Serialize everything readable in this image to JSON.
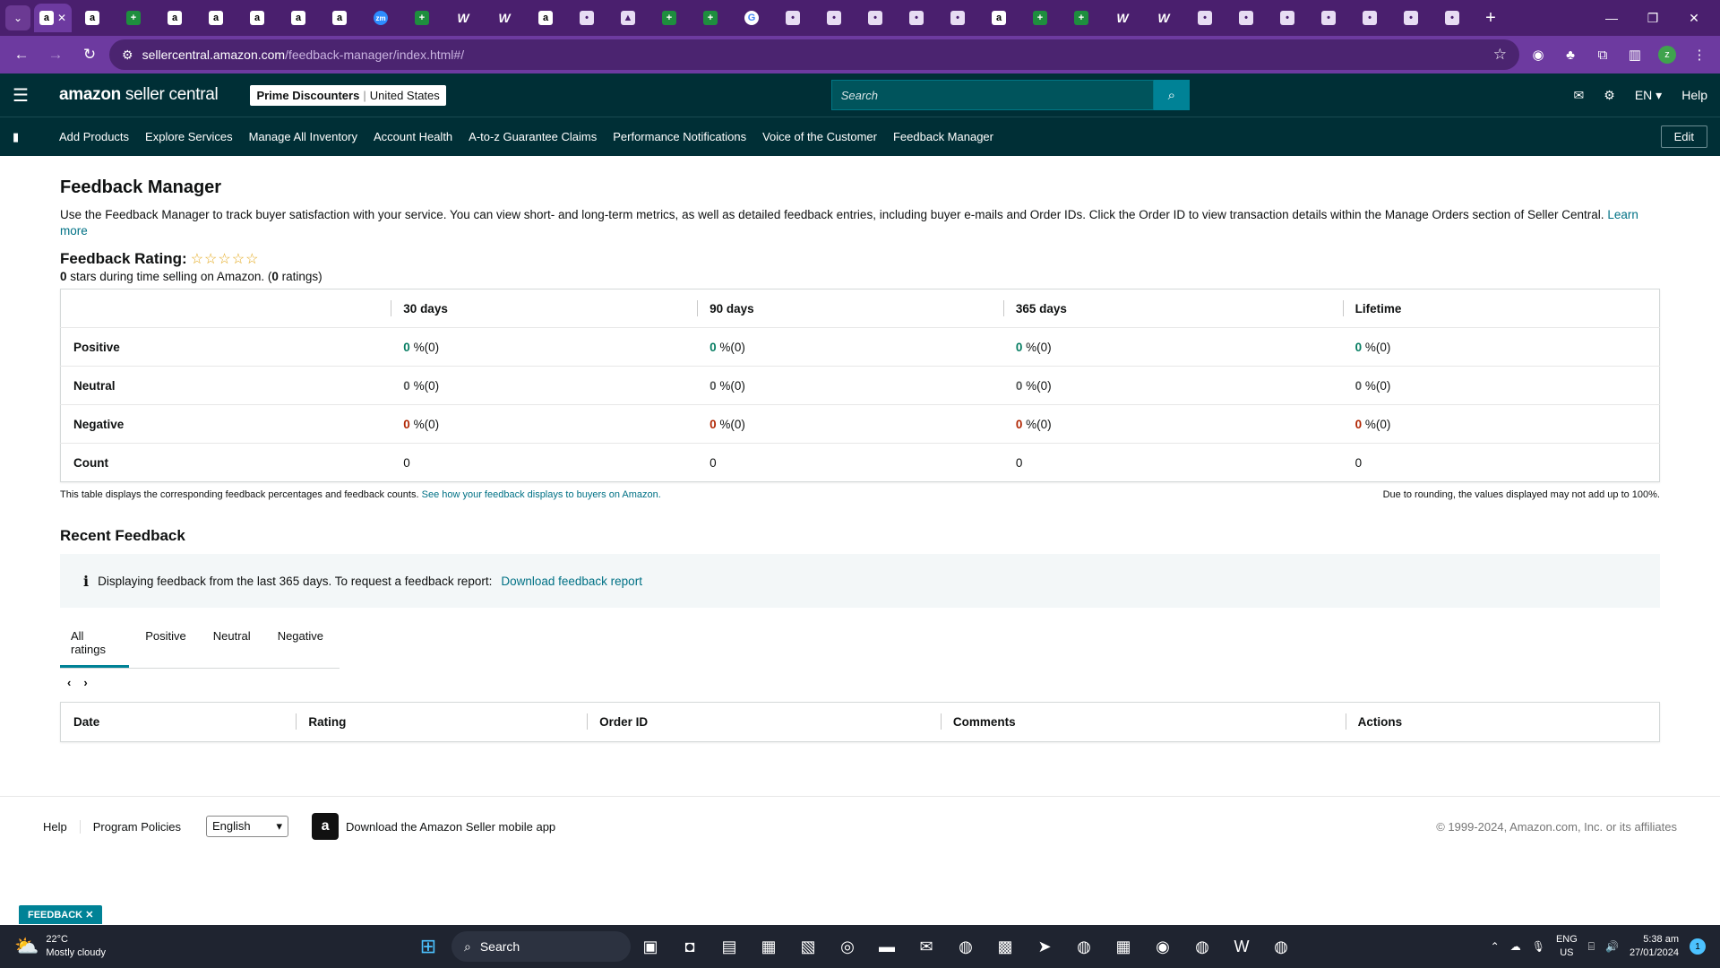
{
  "browser": {
    "tabs": [
      {
        "icon": "amazon",
        "active": true
      },
      {
        "icon": "amazon"
      },
      {
        "icon": "sheets"
      },
      {
        "icon": "amazon"
      },
      {
        "icon": "amazon"
      },
      {
        "icon": "amazon"
      },
      {
        "icon": "amazon"
      },
      {
        "icon": "amazon"
      },
      {
        "icon": "zoom"
      },
      {
        "icon": "sheets"
      },
      {
        "icon": "w"
      },
      {
        "icon": "w"
      },
      {
        "icon": "amazon"
      },
      {
        "icon": "other"
      },
      {
        "icon": "drive"
      },
      {
        "icon": "sheets"
      },
      {
        "icon": "sheets"
      },
      {
        "icon": "google"
      },
      {
        "icon": "other"
      },
      {
        "icon": "other"
      },
      {
        "icon": "other"
      },
      {
        "icon": "other"
      },
      {
        "icon": "other"
      },
      {
        "icon": "amazon"
      },
      {
        "icon": "sheets"
      },
      {
        "icon": "sheets"
      },
      {
        "icon": "w"
      },
      {
        "icon": "w"
      },
      {
        "icon": "other"
      },
      {
        "icon": "other"
      },
      {
        "icon": "other"
      },
      {
        "icon": "other"
      },
      {
        "icon": "other"
      },
      {
        "icon": "other"
      },
      {
        "icon": "other"
      }
    ],
    "url_host": "sellercentral.amazon.com",
    "url_path": "/feedback-manager/index.html#/",
    "profile_initial": "z"
  },
  "header": {
    "logo_bold": "amazon",
    "logo_rest": " seller central",
    "store_name": "Prime Discounters",
    "store_region": "United States",
    "search_placeholder": "Search",
    "language": "EN",
    "help": "Help"
  },
  "nav": {
    "links": [
      "Add Products",
      "Explore Services",
      "Manage All Inventory",
      "Account Health",
      "A-to-z Guarantee Claims",
      "Performance Notifications",
      "Voice of the Customer",
      "Feedback Manager"
    ],
    "edit": "Edit"
  },
  "page": {
    "title": "Feedback Manager",
    "intro": "Use the Feedback Manager to track buyer satisfaction with your service. You can view short- and long-term metrics, as well as detailed feedback entries, including buyer e-mails and Order IDs. Click the Order ID to view transaction details within the Manage Orders section of Seller Central.",
    "learn_more": "Learn more",
    "rating_label": "Feedback Rating:",
    "stars": "☆☆☆☆☆",
    "stars_value": "0",
    "summary_text": " stars during time selling on Amazon. (",
    "ratings_count": "0",
    "ratings_suffix": " ratings)"
  },
  "metrics": {
    "columns": [
      "30 days",
      "90 days",
      "365 days",
      "Lifetime"
    ],
    "rows": [
      {
        "label": "Positive",
        "cells": [
          {
            "pct": "0",
            "rest": " %(0)"
          },
          {
            "pct": "0",
            "rest": " %(0)"
          },
          {
            "pct": "0",
            "rest": " %(0)"
          },
          {
            "pct": "0",
            "rest": " %(0)"
          }
        ]
      },
      {
        "label": "Neutral",
        "cells": [
          {
            "pct": "0",
            "rest": " %(0)"
          },
          {
            "pct": "0",
            "rest": " %(0)"
          },
          {
            "pct": "0",
            "rest": " %(0)"
          },
          {
            "pct": "0",
            "rest": " %(0)"
          }
        ]
      },
      {
        "label": "Negative",
        "cells": [
          {
            "pct": "0",
            "rest": " %(0)"
          },
          {
            "pct": "0",
            "rest": " %(0)"
          },
          {
            "pct": "0",
            "rest": " %(0)"
          },
          {
            "pct": "0",
            "rest": " %(0)"
          }
        ]
      }
    ],
    "count_label": "Count",
    "counts": [
      "0",
      "0",
      "0",
      "0"
    ],
    "note_left": "This table displays the corresponding feedback percentages and feedback counts.",
    "note_link": "See how your feedback displays to buyers on Amazon.",
    "note_right": "Due to rounding, the values displayed may not add up to 100%."
  },
  "recent": {
    "title": "Recent Feedback",
    "info_icon": "i",
    "info_text": "Displaying feedback from the last 365 days. To request a feedback report:",
    "info_link": "Download feedback report",
    "tabs": [
      "All ratings",
      "Positive",
      "Neutral",
      "Negative"
    ],
    "active_tab": "All ratings",
    "columns": [
      "Date",
      "Rating",
      "Order ID",
      "Comments",
      "Actions"
    ]
  },
  "footer": {
    "help": "Help",
    "policies": "Program Policies",
    "language": "English",
    "app_text": "Download the Amazon Seller mobile app",
    "copyright": "© 1999-2024, Amazon.com, Inc. or its affiliates"
  },
  "feedback_tag": "FEEDBACK",
  "taskbar": {
    "temp": "22°C",
    "weather": "Mostly cloudy",
    "search": "Search",
    "lang_top": "ENG",
    "lang_bottom": "US",
    "time": "5:38 am",
    "date": "27/01/2024",
    "notifications": "1"
  },
  "colors": {
    "browser_frame": "#4a1f6e",
    "seller_header": "#002f36",
    "positive": "#067d62",
    "negative": "#b12704",
    "link": "#007185"
  }
}
